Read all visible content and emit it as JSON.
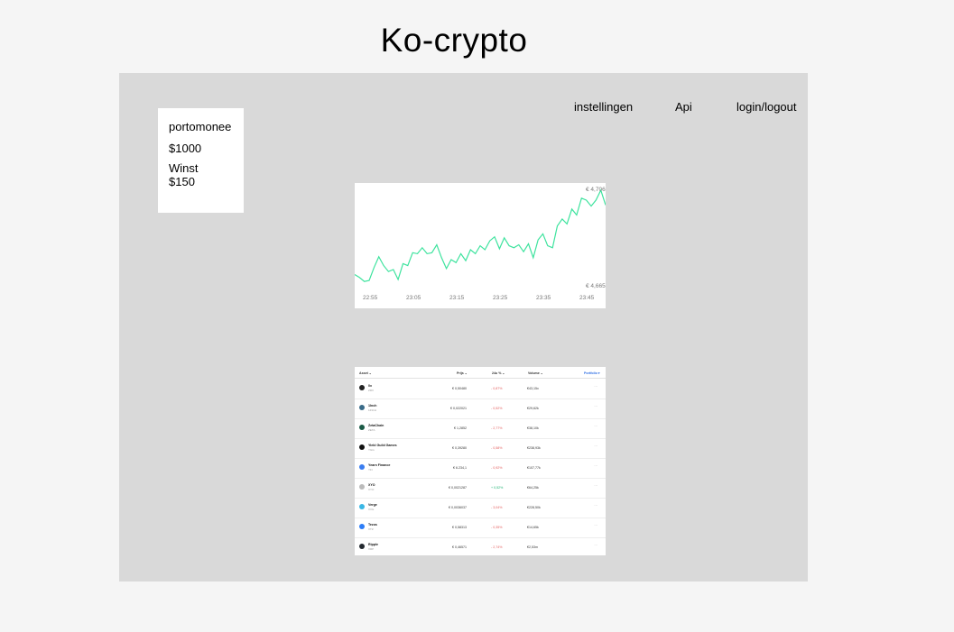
{
  "app": {
    "title": "Ko-crypto"
  },
  "nav": [
    {
      "label": "instellingen"
    },
    {
      "label": "Api"
    },
    {
      "label": "login/logout"
    }
  ],
  "wallet": {
    "title": "portomonee",
    "balance": "$1000",
    "profit_label": "Winst",
    "profit_value": "$150"
  },
  "chart_data": {
    "type": "line",
    "x_ticks": [
      "22:55",
      "23:05",
      "23:15",
      "23:25",
      "23:35",
      "23:45"
    ],
    "y_labels": {
      "top": "€ 4,7063",
      "bottom": "€ 4,6652"
    },
    "series_color": "#3ee39e",
    "values": [
      0.15,
      0.12,
      0.08,
      0.09,
      0.22,
      0.33,
      0.24,
      0.18,
      0.2,
      0.1,
      0.26,
      0.24,
      0.37,
      0.36,
      0.42,
      0.36,
      0.37,
      0.45,
      0.32,
      0.21,
      0.3,
      0.27,
      0.36,
      0.29,
      0.4,
      0.36,
      0.44,
      0.4,
      0.49,
      0.53,
      0.41,
      0.52,
      0.44,
      0.42,
      0.45,
      0.38,
      0.46,
      0.32,
      0.5,
      0.56,
      0.44,
      0.42,
      0.64,
      0.71,
      0.66,
      0.81,
      0.75,
      0.92,
      0.9,
      0.84,
      0.9,
      1.0,
      0.85
    ]
  },
  "table": {
    "headers": {
      "asset": "Asset ⌄",
      "price": "Prijs ⌄",
      "change": "24u % ⌄",
      "volume": "Volume ⌄",
      "portfolio": "Portfolio ▾"
    },
    "rows": [
      {
        "name": "0x",
        "symbol": "ZRX",
        "price": "€ 0,50480",
        "change": "- 0,87%",
        "volume": "€43,15x",
        "icon_color": "#222222",
        "positive": false
      },
      {
        "name": "1Inch",
        "symbol": "1INCH",
        "price": "€ 0,022021",
        "change": "- 0,52%",
        "volume": "€29,62k",
        "icon_color": "#3a6b88",
        "positive": false
      },
      {
        "name": "ZetaChain",
        "symbol": "ZETA",
        "price": "€ 1,2852",
        "change": "- 2,77%",
        "volume": "€38,10k",
        "icon_color": "#1b5a46",
        "positive": false
      },
      {
        "name": "Yield Guild Games",
        "symbol": "YGG",
        "price": "€ 0,39280",
        "change": "- 0,58%",
        "volume": "€238,93k",
        "icon_color": "#111111",
        "positive": false
      },
      {
        "name": "Yearn Finance",
        "symbol": "YFI",
        "price": "€ 6.234,1",
        "change": "- 0,92%",
        "volume": "€107,77k",
        "icon_color": "#3a7df0",
        "positive": false
      },
      {
        "name": "XYO",
        "symbol": "XYO",
        "price": "€ 0,0021287",
        "change": "+ 0,52%",
        "volume": "€64,25k",
        "icon_color": "#bbbbbb",
        "positive": true
      },
      {
        "name": "Verge",
        "symbol": "XVG",
        "price": "€ 0,0036037",
        "change": "- 3,04%",
        "volume": "€228,50k",
        "icon_color": "#3ab7e5",
        "positive": false
      },
      {
        "name": "Tezos",
        "symbol": "XTZ",
        "price": "€ 0,58313",
        "change": "- 0,35%",
        "volume": "€14,65k",
        "icon_color": "#2c7df7",
        "positive": false
      },
      {
        "name": "Ripple",
        "symbol": "XRP",
        "price": "€ 0,46571",
        "change": "- 2,74%",
        "volume": "€2,53m",
        "icon_color": "#23292f",
        "positive": false
      }
    ]
  }
}
